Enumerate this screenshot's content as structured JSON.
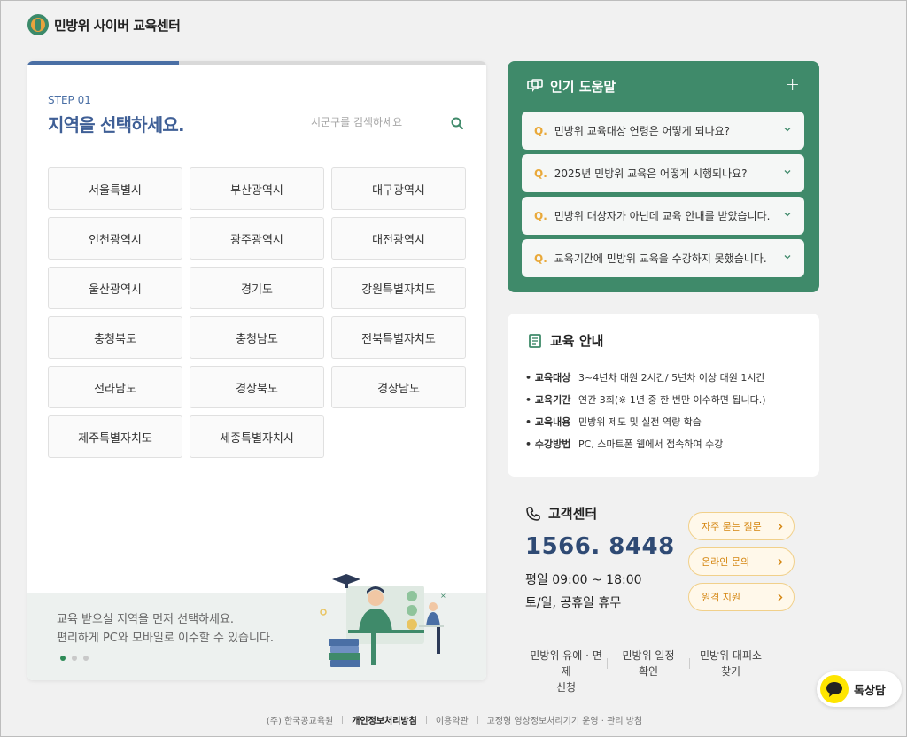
{
  "header": {
    "logo_text": "민방위 사이버 교육센터"
  },
  "region_panel": {
    "step": "STEP 01",
    "title": "지역을 선택하세요.",
    "search_placeholder": "시군구를 검색하세요",
    "progress_fraction": 0.33,
    "regions": [
      "서울특별시",
      "부산광역시",
      "대구광역시",
      "인천광역시",
      "광주광역시",
      "대전광역시",
      "울산광역시",
      "경기도",
      "강원특별자치도",
      "충청북도",
      "충청남도",
      "전북특별자치도",
      "전라남도",
      "경상북도",
      "경상남도",
      "제주특별자치도",
      "세종특별자치시"
    ],
    "bottom_line1": "교육 받으실 지역을 먼저 선택하세요.",
    "bottom_line2": "편리하게 PC와 모바일로 이수할 수 있습니다."
  },
  "faq": {
    "title": "인기 도움말",
    "plus": "+",
    "q_mark": "Q.",
    "items": [
      "민방위 교육대상 연령은 어떻게 되나요?",
      "2025년 민방위 교육은 어떻게 시행되나요?",
      "민방위 대상자가 아닌데 교육 안내를 받았습니다.",
      "교육기간에 민방위 교육을 수강하지 못했습니다."
    ]
  },
  "info": {
    "title": "교육 안내",
    "rows": [
      {
        "key": "교육대상",
        "value": "3~4년차 대원 2시간/ 5년차 이상 대원 1시간"
      },
      {
        "key": "교육기간",
        "value": "연간 3회(※ 1년 중 한 번만 이수하면 됩니다.)"
      },
      {
        "key": "교육내용",
        "value": "민방위 제도 및 실전 역량 학습"
      },
      {
        "key": "수강방법",
        "value": "PC, 스마트폰 웹에서 접속하여 수강"
      }
    ]
  },
  "customer_center": {
    "title": "고객센터",
    "phone": "1566. 8448",
    "hours_weekday": "평일 09:00 ~ 18:00",
    "hours_weekend": "토/일, 공휴일 휴무",
    "buttons": [
      "자주 묻는 질문",
      "온라인 문의",
      "원격 지원"
    ]
  },
  "quick_links": [
    {
      "line1": "민방위 유예 · 면제",
      "line2": "신청"
    },
    {
      "line1": "민방위 일정",
      "line2": "확인"
    },
    {
      "line1": "민방위 대피소",
      "line2": "찾기"
    }
  ],
  "talk": {
    "label": "톡상담"
  },
  "footer": {
    "company": "(주) 한국공교육원",
    "privacy": "개인정보처리방침",
    "terms": "이용약관",
    "cctv": "고정형 영상정보처리기기 운영 · 관리 방침"
  },
  "colors": {
    "primary_blue": "#3f5f96",
    "green": "#3f8a6a",
    "accent_orange": "#e9a93a"
  }
}
